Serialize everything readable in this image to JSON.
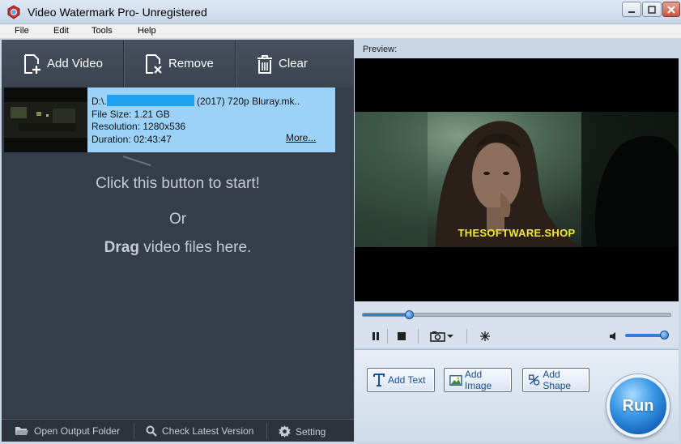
{
  "window": {
    "title": "Video Watermark Pro- Unregistered"
  },
  "menu": [
    "File",
    "Edit",
    "Tools",
    "Help"
  ],
  "toolbar": {
    "add_video": "Add Video",
    "remove": "Remove",
    "clear": "Clear"
  },
  "file_list": {
    "items": [
      {
        "path_prefix": "D:\\.",
        "path_suffix": "(2017) 720p Bluray.mk..",
        "file_size": "File Size: 1.21 GB",
        "resolution": "Resolution: 1280x536",
        "duration": "Duration: 02:43:47",
        "more": "More..."
      }
    ]
  },
  "empty_hint": {
    "line1": "Click this button to start!",
    "line2": "Or",
    "drag_bold": "Drag",
    "drag_rest": " video files here."
  },
  "bottom_bar": {
    "open_output": "Open Output Folder",
    "check_version": "Check Latest Version",
    "setting": "Setting"
  },
  "preview": {
    "label": "Preview:",
    "watermark_text": "THESOFTWARE.SHOP",
    "seek_fraction": 0.15,
    "volume_fraction": 0.95
  },
  "actions": {
    "add_text": "Add Text",
    "add_image": "Add Image",
    "add_shape": "Add Shape",
    "run": "Run"
  },
  "colors": {
    "panel_dark": "#343d4a",
    "selection": "#9cd2f8",
    "accent": "#2f7fd4",
    "watermark": "#f2ea2a"
  }
}
